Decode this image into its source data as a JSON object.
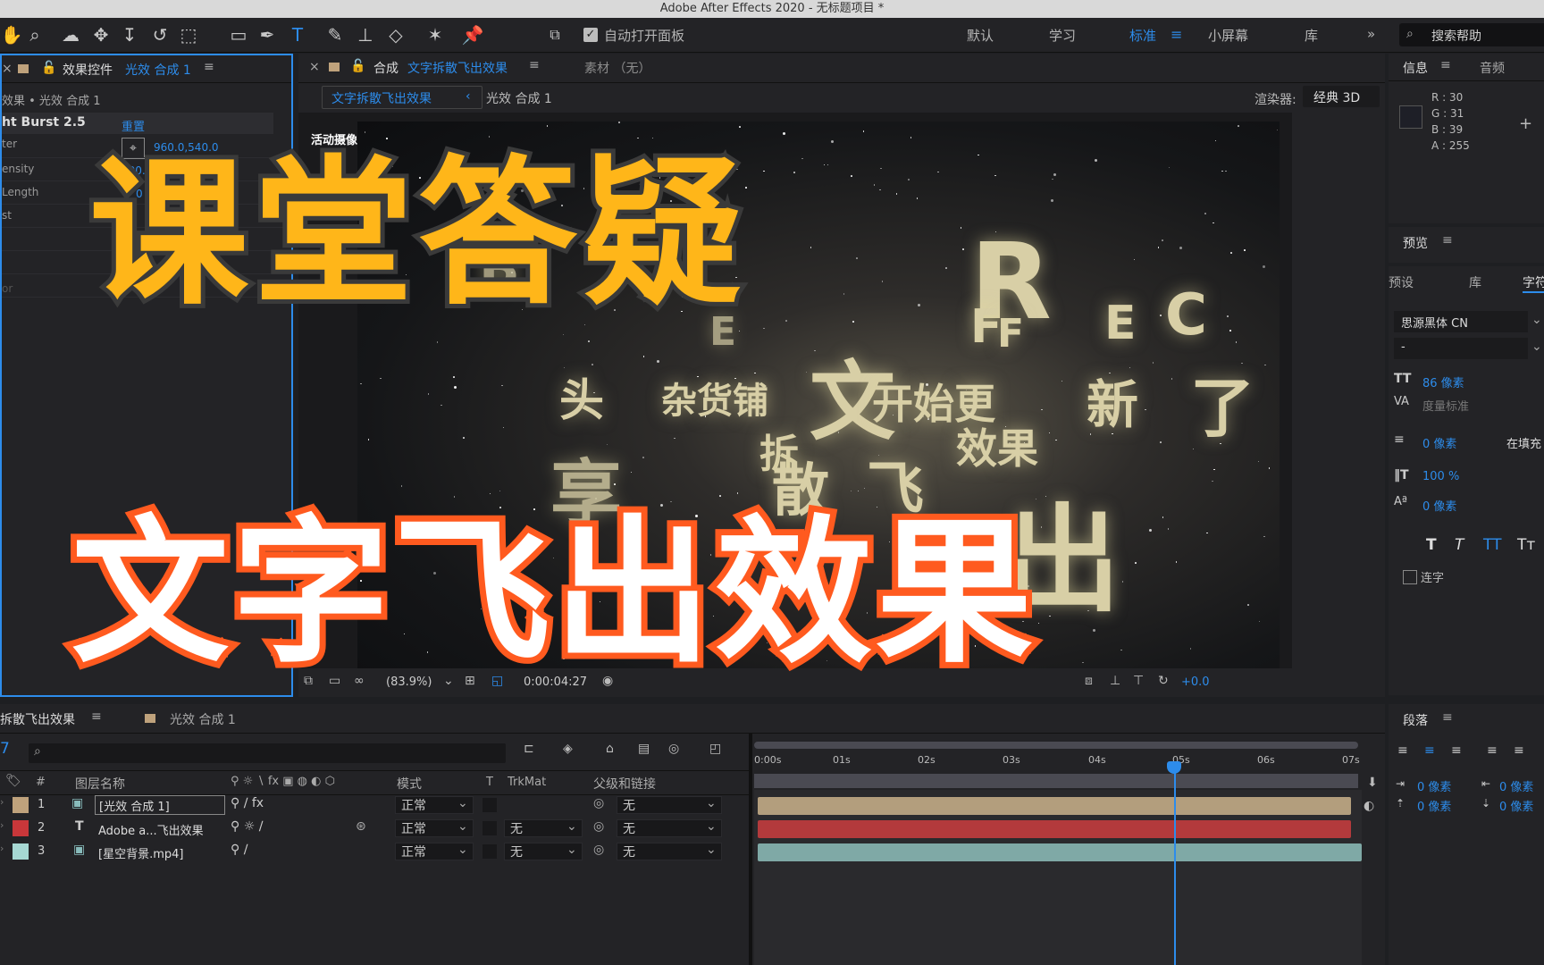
{
  "window": {
    "title": "Adobe After Effects 2020 - 无标题项目 *"
  },
  "toolbar": {
    "auto_open_label": "自动打开面板",
    "workspaces": [
      "默认",
      "学习",
      "标准",
      "小屏幕",
      "库"
    ],
    "active_workspace": "标准",
    "search_placeholder": "搜索帮助"
  },
  "effect_controls": {
    "tab_prefix": "效果控件",
    "tab_target": "光效 合成 1",
    "breadcrumb": "效果 • 光效 合成 1",
    "effect_name": "ht Burst 2.5",
    "reset_label": "重置",
    "props": [
      {
        "name": "ter",
        "value": "960.0,540.0"
      },
      {
        "name": "ensity",
        "value": "100.0"
      },
      {
        "name": "Length",
        "value": "0"
      },
      {
        "name": "st",
        "value": ""
      },
      {
        "name": "or",
        "value": ""
      }
    ]
  },
  "composition": {
    "tab_prefix": "合成",
    "tab_name": "文字拆散飞出效果",
    "footage_label": "素材 （无）",
    "crumb_active": "文字拆散飞出效果",
    "crumb_other": "光效 合成 1",
    "renderer_label": "渲染器:",
    "renderer_value": "经典 3D",
    "camera_label": "活动摄像机",
    "zoom": "(83.9%)",
    "timecode": "0:00:04:27",
    "exposure": "+0.0"
  },
  "canvas_text": {
    "letters": [
      "R",
      "B",
      "E",
      "F",
      "F",
      "E",
      "C"
    ],
    "words": [
      "头",
      "杂货铺",
      "文",
      "开始更",
      "新",
      "了",
      "拆",
      "散",
      "飞",
      "效果",
      "享",
      "出"
    ]
  },
  "overlay": {
    "title_line1": "课堂答疑",
    "title_line2": "文字飞出效果"
  },
  "info_panel": {
    "tab_info": "信息",
    "tab_audio": "音频",
    "r": "R :  30",
    "g": "G :  31",
    "b": "B :  39",
    "a": "A :  255",
    "swatch_color": "#1e1f27"
  },
  "preview_panel": {
    "title": "预览"
  },
  "character_panel": {
    "tab_presets": "预设",
    "tab_library": "库",
    "tab_char": "字符",
    "font": "思源黑体 CN",
    "style": "-",
    "size": "86 像素",
    "kerning": "度量标准",
    "stroke": "0 像素",
    "stroke_mode": "在填充",
    "vscale": "100 %",
    "baseline": "0 像素",
    "ligature_label": "连字"
  },
  "paragraph_panel": {
    "title": "段落",
    "indent1": "0 像素",
    "indent2": "0 像素",
    "indent3": "0 像素",
    "indent4": "0 像素"
  },
  "timeline": {
    "tab_active": "拆散飞出效果",
    "tab_other": "光效 合成 1",
    "current_time_short": "7",
    "columns": {
      "num": "#",
      "name": "图层名称",
      "mode": "模式",
      "t": "T",
      "trkmat": "TrkMat",
      "parent": "父级和链接"
    },
    "ruler": [
      "0:00s",
      "01s",
      "02s",
      "03s",
      "04s",
      "05s",
      "06s",
      "07s"
    ],
    "layers": [
      {
        "num": "1",
        "name": "[光效 合成 1]",
        "mode": "正常",
        "trkmat": "",
        "parent": "无",
        "color": "#bfa27c",
        "bar": "#b39e7d"
      },
      {
        "num": "2",
        "name": "Adobe a...飞出效果",
        "mode": "正常",
        "trkmat": "无",
        "parent": "无",
        "color": "#c8373a",
        "bar": "#b33a3c"
      },
      {
        "num": "3",
        "name": "[星空背景.mp4]",
        "mode": "正常",
        "trkmat": "无",
        "parent": "无",
        "color": "#a6d8d3",
        "bar": "#7fa9a6"
      }
    ]
  },
  "colors": {
    "accent": "#2d8ceb",
    "title_yellow": "#ffb619",
    "title_orange": "#ff5a1f"
  }
}
